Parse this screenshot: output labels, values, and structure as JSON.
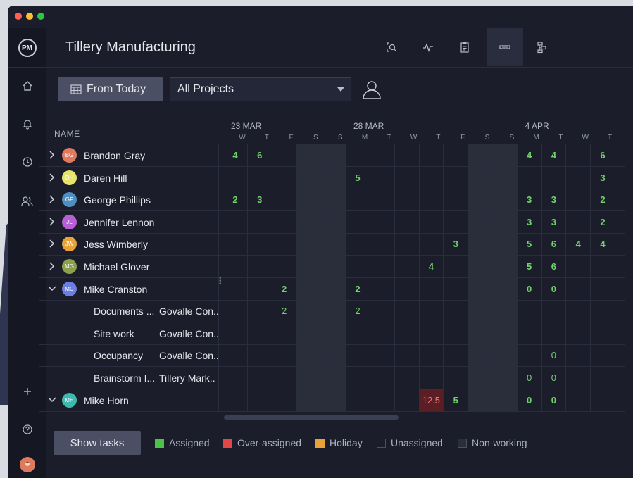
{
  "window": {
    "controls": [
      "close",
      "minimize",
      "maximize"
    ],
    "control_colors": [
      "#ff5f57",
      "#febc2e",
      "#28c840"
    ]
  },
  "app": {
    "logo": "PM",
    "title": "Tillery Manufacturing"
  },
  "header_icons": [
    "search-doc-icon",
    "activity-icon",
    "clipboard-icon",
    "workload-icon",
    "hierarchy-icon"
  ],
  "sidebar_icons": [
    "home-icon",
    "bell-icon",
    "clock-icon",
    "team-icon",
    "plus-icon",
    "help-icon",
    "user-avatar"
  ],
  "toolbar": {
    "from_today": "From Today",
    "projects_select": "All Projects"
  },
  "table": {
    "name_header": "NAME",
    "date_groups": [
      {
        "label": "23 MAR"
      },
      {
        "label": "28 MAR"
      },
      {
        "label": "4 APR"
      }
    ],
    "days": [
      "W",
      "T",
      "F",
      "S",
      "S",
      "M",
      "T",
      "W",
      "T",
      "F",
      "S",
      "S",
      "M",
      "T",
      "W",
      "T"
    ],
    "rows": [
      {
        "type": "person",
        "name": "Brandon Gray",
        "initials": "BG",
        "color": "#e07a5f",
        "expanded": false,
        "cells": [
          "4",
          "6",
          "",
          "",
          "",
          "",
          "",
          "",
          "",
          "",
          "",
          "",
          "4",
          "4",
          "",
          "6"
        ]
      },
      {
        "type": "person",
        "name": "Daren Hill",
        "initials": "DH",
        "color": "#e8e36a",
        "expanded": false,
        "cells": [
          "",
          "",
          "",
          "",
          "",
          "5",
          "",
          "",
          "",
          "",
          "",
          "",
          "",
          "",
          "",
          "3"
        ]
      },
      {
        "type": "person",
        "name": "George Phillips",
        "initials": "GP",
        "color": "#4f8fc0",
        "expanded": false,
        "cells": [
          "2",
          "3",
          "",
          "",
          "",
          "",
          "",
          "",
          "",
          "",
          "",
          "",
          "3",
          "3",
          "",
          "2"
        ]
      },
      {
        "type": "person",
        "name": "Jennifer Lennon",
        "initials": "JL",
        "color": "#b65fd6",
        "expanded": false,
        "cells": [
          "",
          "",
          "",
          "",
          "",
          "",
          "",
          "",
          "",
          "",
          "",
          "",
          "3",
          "3",
          "",
          "2"
        ]
      },
      {
        "type": "person",
        "name": "Jess Wimberly",
        "initials": "JW",
        "color": "#e8a23a",
        "expanded": false,
        "cells": [
          "",
          "",
          "",
          "",
          "",
          "",
          "",
          "",
          "",
          "3",
          "",
          "",
          "5",
          "6",
          "4",
          "4"
        ]
      },
      {
        "type": "person",
        "name": "Michael Glover",
        "initials": "MG",
        "color": "#8aa04a",
        "expanded": false,
        "cells": [
          "",
          "",
          "",
          "",
          "",
          "",
          "",
          "",
          "4",
          "",
          "",
          "",
          "5",
          "6",
          "",
          ""
        ]
      },
      {
        "type": "person",
        "name": "Mike Cranston",
        "initials": "MC",
        "color": "#6c7fe0",
        "expanded": true,
        "cells": [
          "",
          "",
          "2",
          "",
          "",
          "2",
          "",
          "",
          "",
          "",
          "",
          "",
          "0",
          "0",
          "",
          ""
        ]
      },
      {
        "type": "task",
        "name": "Documents ...",
        "project": "Govalle Con..",
        "cells": [
          "",
          "",
          "2",
          "",
          "",
          "2",
          "",
          "",
          "",
          "",
          "",
          "",
          "",
          "",
          "",
          ""
        ]
      },
      {
        "type": "task",
        "name": "Site work",
        "project": "Govalle Con..",
        "cells": [
          "",
          "",
          "",
          "",
          "",
          "",
          "",
          "",
          "",
          "",
          "",
          "",
          "",
          "",
          "",
          ""
        ]
      },
      {
        "type": "task",
        "name": "Occupancy",
        "project": "Govalle Con..",
        "cells": [
          "",
          "",
          "",
          "",
          "",
          "",
          "",
          "",
          "",
          "",
          "",
          "",
          "",
          "0",
          "",
          ""
        ]
      },
      {
        "type": "task",
        "name": "Brainstorm I...",
        "project": "Tillery Mark..",
        "cells": [
          "",
          "",
          "",
          "",
          "",
          "",
          "",
          "",
          "",
          "",
          "",
          "",
          "0",
          "0",
          "",
          ""
        ]
      },
      {
        "type": "person",
        "name": "Mike Horn",
        "initials": "MH",
        "color": "#3fb8b0",
        "expanded": true,
        "cells": [
          "",
          "",
          "",
          "",
          "",
          "",
          "",
          "",
          "12.5",
          "5",
          "",
          "",
          "0",
          "0",
          "",
          ""
        ]
      }
    ]
  },
  "footer": {
    "show_tasks": "Show tasks",
    "legend": [
      {
        "label": "Assigned",
        "color": "#4cc24a"
      },
      {
        "label": "Over-assigned",
        "color": "#e04848"
      },
      {
        "label": "Holiday",
        "color": "#e8a23a"
      },
      {
        "label": "Unassigned",
        "color": "#1b1d2a"
      },
      {
        "label": "Non-working",
        "color": "#2a2d3a"
      }
    ]
  }
}
